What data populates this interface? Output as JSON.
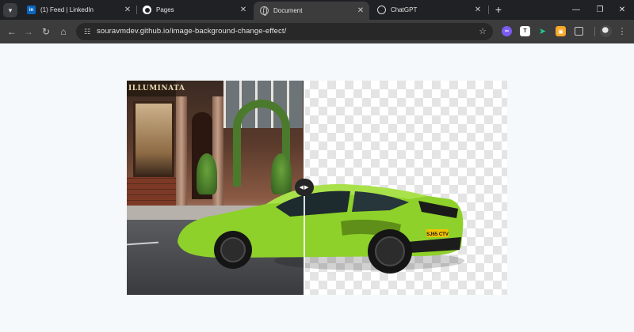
{
  "browser": {
    "tabs": [
      {
        "label": "(1) Feed | LinkedIn",
        "favicon": "linkedin-icon",
        "active": false
      },
      {
        "label": "Pages",
        "favicon": "github-icon",
        "active": false
      },
      {
        "label": "Document",
        "favicon": "globe-icon",
        "active": true
      },
      {
        "label": "ChatGPT",
        "favicon": "chatgpt-icon",
        "active": false
      }
    ],
    "tab_search_icon": "chevron-down-icon",
    "new_tab_icon": "plus-icon",
    "linkedin_badge": "in",
    "window_controls": [
      "minimize-icon",
      "restore-icon",
      "close-icon"
    ],
    "nav": [
      "back-icon",
      "forward-icon",
      "reload-icon",
      "home-icon"
    ],
    "url": "souravmdev.github.io/image-background-change-effect/",
    "bookmark_icon": "star-icon",
    "extensions": [
      {
        "icon": "infinity-icon",
        "color": "#7b5cf0"
      },
      {
        "icon": "text-t-icon",
        "glyph": "T",
        "color": "#ffffff"
      },
      {
        "icon": "bird-icon",
        "color": "#1ec997"
      },
      {
        "icon": "orange-square-icon",
        "color": "#f7a928"
      },
      {
        "icon": "puzzle-icon",
        "color": "#c7c7c7"
      }
    ]
  },
  "page": {
    "background": "#f5f9fc",
    "comparison": {
      "left_image": "car-with-street-background",
      "right_image": "car-with-transparent-background",
      "shop_sign": "ILLUMINATA",
      "plate": "SJ65 CTV",
      "car_color": "#8ed12a",
      "slider_position_percent": 46.5,
      "handle_icon": "left-right-arrows-icon"
    }
  }
}
